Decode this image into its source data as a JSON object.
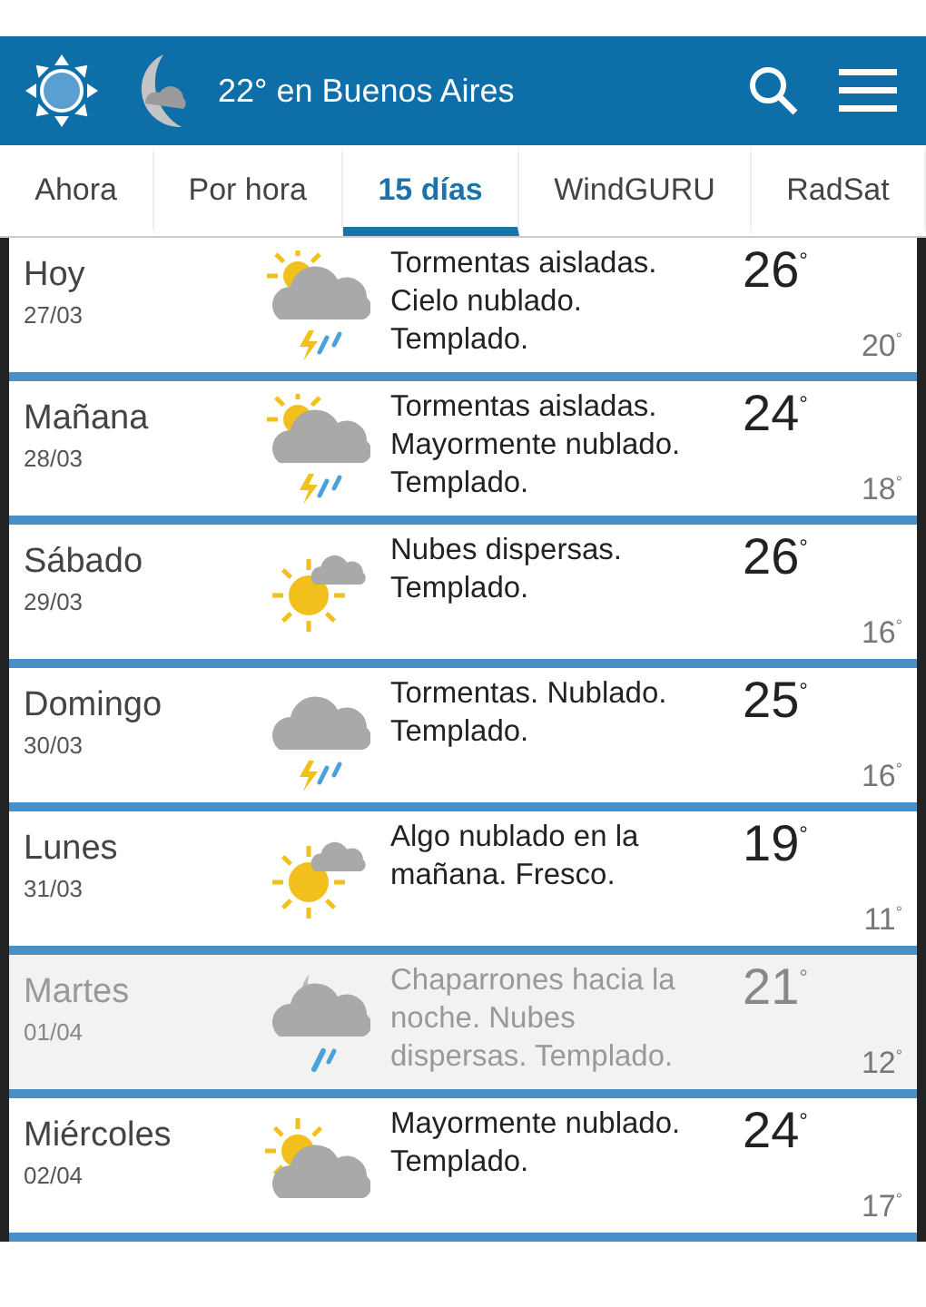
{
  "header": {
    "title": "22° en Buenos Aires"
  },
  "tabs": [
    {
      "label": "Ahora",
      "selected": false
    },
    {
      "label": "Por hora",
      "selected": false
    },
    {
      "label": "15 días",
      "selected": true
    },
    {
      "label": "WindGURU",
      "selected": false
    },
    {
      "label": "RadSat",
      "selected": false
    }
  ],
  "days": [
    {
      "day": "Hoy",
      "date": "27/03",
      "kind": "storm-sun",
      "text": "Tormentas aisladas. Cielo nublado. Templado.",
      "high": "26$^{°}$",
      "low": "20$^{°}$",
      "dimmed": false
    },
    {
      "day": "Mañana",
      "date": "28/03",
      "kind": "storm-sun",
      "text": "Tormentas aisladas. Mayormente nublado. Templado.",
      "high": "24$^{°}$",
      "low": "18$^{°}$",
      "dimmed": false
    },
    {
      "day": "Sábado",
      "date": "29/03",
      "kind": "sun-cloud",
      "text": "Nubes dispersas. Templado.",
      "high": "26$^{°}$",
      "low": "16$^{°}$",
      "dimmed": false
    },
    {
      "day": "Domingo",
      "date": "30/03",
      "kind": "storm",
      "text": "Tormentas. Nublado. Templado.",
      "high": "25$^{°}$",
      "low": "16$^{°}$",
      "dimmed": false
    },
    {
      "day": "Lunes",
      "date": "31/03",
      "kind": "sun-cloud",
      "text": "Algo nublado en la mañana. Fresco.",
      "high": "19$^{°}$",
      "low": "11$^{°}$",
      "dimmed": false
    },
    {
      "day": "Martes",
      "date": "01/04",
      "kind": "moon-rain",
      "text": "Chaparrones hacia la noche. Nubes dispersas. Templado.",
      "high": "21$^{°}$",
      "low": "12$^{°}$",
      "dimmed": true
    },
    {
      "day": "Miércoles",
      "date": "02/04",
      "kind": "cloud-sun",
      "text": "Mayormente nublado. Templado.",
      "high": "24$^{°}$",
      "low": "17$^{°}$",
      "dimmed": false
    }
  ]
}
